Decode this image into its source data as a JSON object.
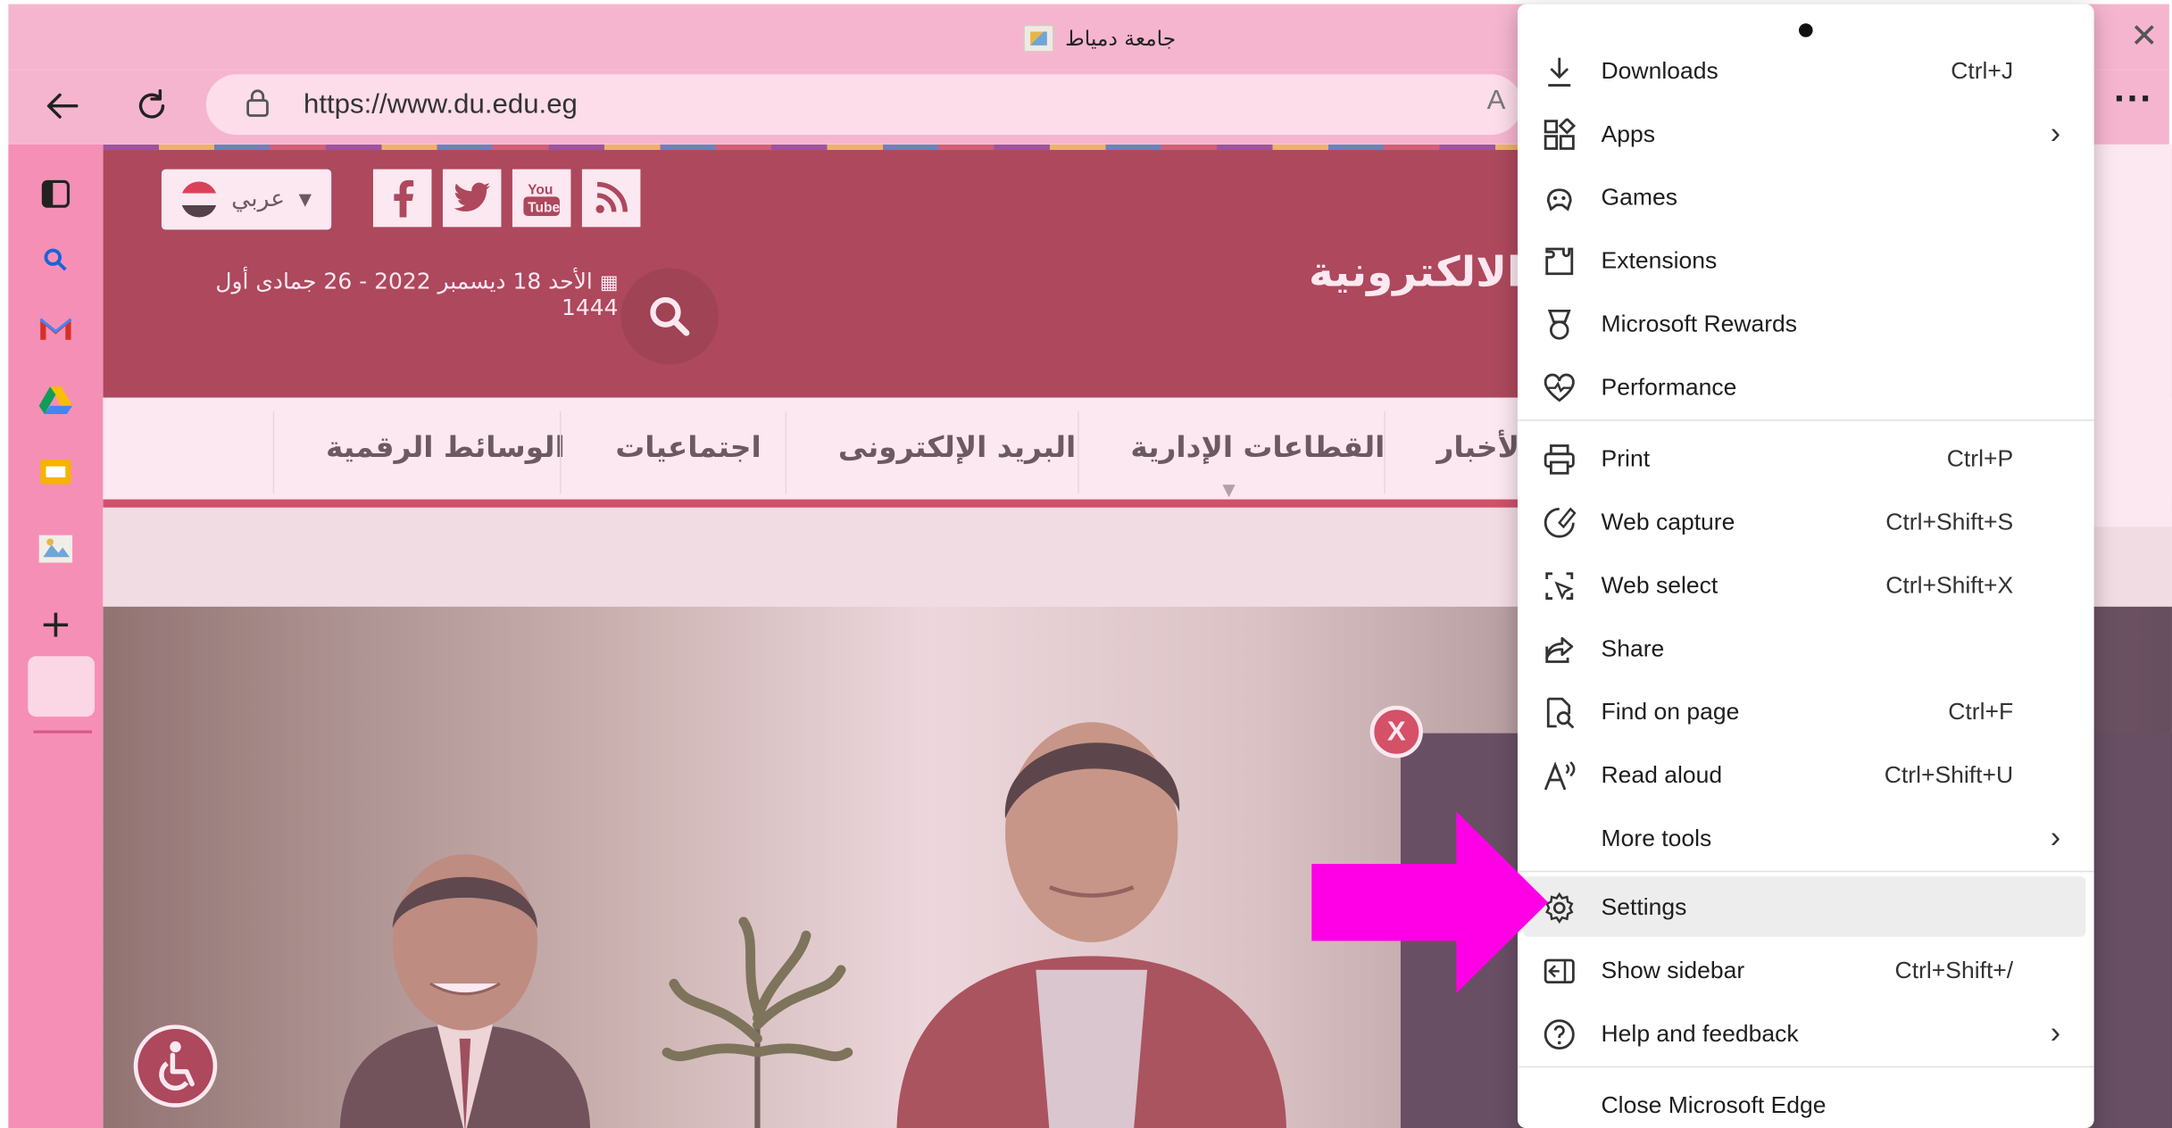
{
  "browser": {
    "tab_title": "جامعة دمياط",
    "url": "https://www.du.edu.eg",
    "read_aloud_glyph": "A",
    "more_label": "···",
    "close_glyph": "✕"
  },
  "sidebar": {
    "items": [
      "tab-actions-icon",
      "search-icon",
      "gmail-icon",
      "drive-icon",
      "slides-icon",
      "university-site-icon"
    ],
    "add_label": "+"
  },
  "site": {
    "language": "عربي",
    "date": "الأحد 18 ديسمبر 2022 - 26 جمادى أول 1444",
    "title_partial": "بة الالكترونية",
    "menu": [
      "الوسائط الرقمية",
      "اجتماعيات",
      "البريد الإلكترونى",
      "القطاعات الإدارية",
      "الأخبار"
    ],
    "popup_close": "X"
  },
  "menu": {
    "items": [
      {
        "label": "Downloads",
        "shortcut": "Ctrl+J",
        "icon": "download-icon"
      },
      {
        "label": "Apps",
        "chevron": true,
        "icon": "apps-icon"
      },
      {
        "label": "Games",
        "icon": "games-icon"
      },
      {
        "label": "Extensions",
        "icon": "extensions-icon"
      },
      {
        "label": "Microsoft Rewards",
        "icon": "rewards-icon"
      },
      {
        "label": "Performance",
        "icon": "performance-icon"
      },
      {
        "label": "Print",
        "shortcut": "Ctrl+P",
        "icon": "print-icon"
      },
      {
        "label": "Web capture",
        "shortcut": "Ctrl+Shift+S",
        "icon": "web-capture-icon"
      },
      {
        "label": "Web select",
        "shortcut": "Ctrl+Shift+X",
        "icon": "web-select-icon"
      },
      {
        "label": "Share",
        "icon": "share-icon"
      },
      {
        "label": "Find on page",
        "shortcut": "Ctrl+F",
        "icon": "find-icon"
      },
      {
        "label": "Read aloud",
        "shortcut": "Ctrl+Shift+U",
        "icon": "read-aloud-icon"
      },
      {
        "label": "More tools",
        "chevron": true,
        "icon": ""
      },
      {
        "label": "Settings",
        "icon": "settings-icon"
      },
      {
        "label": "Show sidebar",
        "shortcut": "Ctrl+Shift+/",
        "icon": "sidebar-icon"
      },
      {
        "label": "Help and feedback",
        "chevron": true,
        "icon": "help-icon"
      },
      {
        "label": "Close Microsoft Edge",
        "icon": ""
      }
    ],
    "chevron_glyph": "›"
  },
  "colors": {
    "browser_pink": "#f6b5cf",
    "sidebar_pink": "#f58fb6",
    "site_maroon": "#8f1b2d",
    "highlight_arrow": "#ff00e6"
  }
}
